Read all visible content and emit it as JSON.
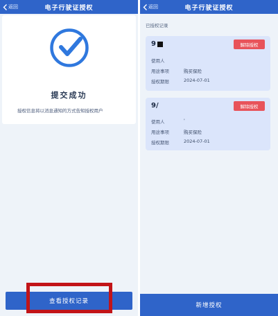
{
  "left_screen": {
    "navbar": {
      "back_label": "返回",
      "title": "电子行驶证授权"
    },
    "success": {
      "title": "提交成功",
      "description": "授权信息将以消息通知的方式告知授权用户"
    },
    "view_records_button": "查看授权记录"
  },
  "right_screen": {
    "navbar": {
      "back_label": "返回",
      "title": "电子行驶证授权"
    },
    "section_label": "已授权记录",
    "records": [
      {
        "name": "9",
        "revoke_label": "解除授权",
        "user_label": "使用人",
        "user_value": "",
        "purpose_label": "用途事项",
        "purpose_value": "购买保险",
        "expiry_label": "授权期限",
        "expiry_value": "2024-07-01"
      },
      {
        "name": "9/",
        "revoke_label": "解除授权",
        "user_label": "使用人",
        "user_value": "'",
        "purpose_label": "用途事项",
        "purpose_value": "购买保险",
        "expiry_label": "授权期限",
        "expiry_value": "2024-07-01"
      }
    ],
    "new_authorization_button": "新增授权"
  },
  "colors": {
    "primary": "#2f64c9",
    "danger": "#e8535a",
    "highlight": "#c21418",
    "check": "#2f78de",
    "card_blue": "#dbe5fb"
  },
  "icons": {
    "back": "chevron-left-icon",
    "success": "checkmark-circle-icon"
  }
}
